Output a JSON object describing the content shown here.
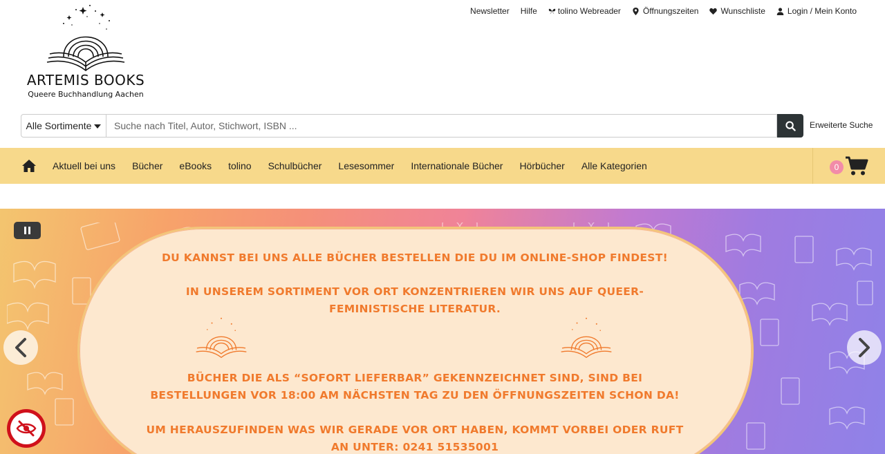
{
  "toplinks": {
    "newsletter": "Newsletter",
    "help": "Hilfe",
    "webreader": "tolino Webreader",
    "hours": "Öffnungszeiten",
    "wishlist": "Wunschliste",
    "login": "Login / Mein Konto"
  },
  "logo": {
    "name": "ARTEMIS BOOKS",
    "subtitle": "Queere Buchhandlung Aachen"
  },
  "search": {
    "category_label": "Alle Sortimente",
    "placeholder": "Suche nach Titel, Autor, Stichwort, ISBN ...",
    "advanced_label": "Erweiterte Suche"
  },
  "nav": {
    "items": [
      "Aktuell bei uns",
      "Bücher",
      "eBooks",
      "tolino",
      "Schulbücher",
      "Lesesommer",
      "Internationale Bücher",
      "Hörbücher",
      "Alle Kategorien"
    ],
    "cart_count": "0"
  },
  "banner": {
    "line1": "Du kannst bei uns alle Bücher bestellen die du im Online-Shop findest!",
    "line2a": "In unserem Sortiment vor Ort konzentrieren wir uns auf queer-",
    "line2b": "feministische Literatur.",
    "line3a": "Bücher die als “sofort lieferbar” gekennzeichnet sind, sind bei",
    "line3b": "Bestellungen vor 18:00 am nächsten Tag zu den Öffnungszeiten schon da!",
    "line4a": "Um herauszufinden was wir gerade vor Ort haben, kommt vorbei oder ruft",
    "line4b": "an unter: 0241 51535001"
  },
  "colors": {
    "nav_bg": "#f7d98b",
    "badge": "#f28ba8",
    "banner_text": "#f07a2d",
    "pill_bg": "#fde8cf",
    "search_button": "#2d3436"
  },
  "icons": {
    "webreader": "butterfly-icon",
    "hours": "map-pin-icon",
    "wishlist": "heart-icon",
    "login": "user-icon",
    "search": "search-icon",
    "home": "home-icon",
    "cart": "cart-icon",
    "pause": "pause-icon",
    "prev": "chevron-left-icon",
    "next": "chevron-right-icon",
    "consent": "eye-slash-icon"
  }
}
